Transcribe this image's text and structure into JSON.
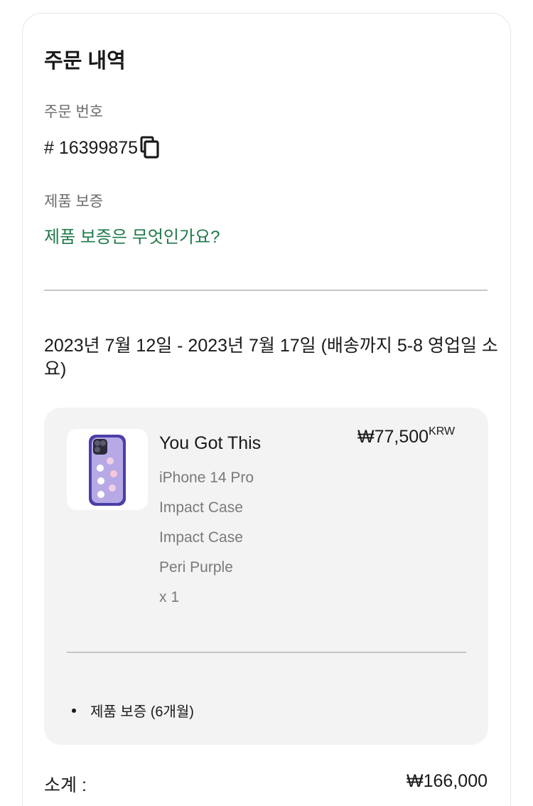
{
  "order": {
    "title": "주문 내역",
    "order_number_label": "주문 번호",
    "order_number": "# 16399875",
    "warranty_label": "제품 보증",
    "warranty_link": "제품 보증은 무엇인가요?",
    "delivery_text": "2023년 7월 12일 - 2023년 7월 17일 (배송까지 5-8 영업일 소요)"
  },
  "item": {
    "name": "You Got This",
    "price": "₩77,500",
    "currency": "KRW",
    "specs": [
      "iPhone 14 Pro",
      "Impact Case",
      "Impact Case",
      "Peri Purple",
      "x 1"
    ],
    "addon": "제품 보증 (6개월)"
  },
  "summary": {
    "subtotal_label": "소계 :",
    "subtotal_value": "₩166,000"
  },
  "colors": {
    "link": "#1f7a4a",
    "case": "#4b3fa8"
  },
  "icons": {
    "copy": "copy-icon"
  }
}
